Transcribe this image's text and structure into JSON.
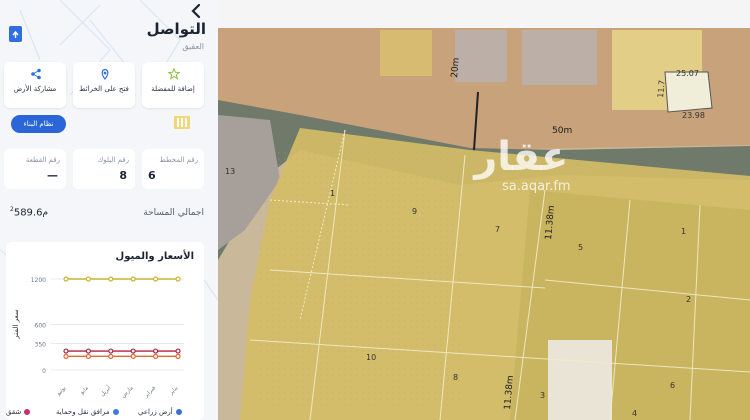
{
  "panel": {
    "title": "التواصل",
    "subtitle": "العقيق",
    "actions": [
      {
        "label": "مشاركة الأرض",
        "icon": "share-icon"
      },
      {
        "label": "فتح على الخرائط",
        "icon": "map-pin-icon"
      },
      {
        "label": "إضافة للمفضلة",
        "icon": "star-icon"
      }
    ],
    "cta_label": "نظام البناء",
    "info": [
      {
        "label": "رقم القطعة",
        "value": "—"
      },
      {
        "label": "رقم البلوك",
        "value": "8"
      },
      {
        "label": "رقم المخطط",
        "value": "6"
      }
    ],
    "area_label": "اجمالي المساحة",
    "area_value": "589.6",
    "area_unit": "م",
    "area_sup": "2"
  },
  "chart": {
    "title": "الأسعار والميول",
    "ylabel": "سعر المتر",
    "legend": [
      {
        "label": "أرض زراعي",
        "color": "#3a6fd8"
      },
      {
        "label": "مرافق نقل وحماية",
        "color": "#3b7be0"
      },
      {
        "label": "شقق",
        "color": "#c0307a"
      }
    ]
  },
  "chart_data": {
    "type": "line",
    "categories": [
      "يناير",
      "فبراير",
      "مارس",
      "أبريل",
      "مايو",
      "يونيو"
    ],
    "yticks": [
      0,
      350,
      600,
      1200
    ],
    "ylim": [
      0,
      1200
    ],
    "series": [
      {
        "color": "#c8b432",
        "values": [
          1200,
          1200,
          1200,
          1200,
          1200,
          1200
        ]
      },
      {
        "color": "#b0203a",
        "values": [
          250,
          250,
          250,
          250,
          250,
          250
        ]
      },
      {
        "color": "#e06a3a",
        "values": [
          180,
          180,
          180,
          180,
          180,
          180
        ]
      }
    ]
  },
  "map": {
    "watermark_ar": "عقار",
    "watermark_url": "sa.aqar.fm",
    "road_labels": [
      "50m",
      "20m",
      "11.38m",
      "11.38m"
    ],
    "plot_numbers": [
      "1",
      "9",
      "7",
      "5",
      "1",
      "2",
      "10",
      "8",
      "3",
      "4",
      "6",
      "13"
    ],
    "parcel_dims": [
      "25.07",
      "23.98",
      "11.7"
    ]
  }
}
